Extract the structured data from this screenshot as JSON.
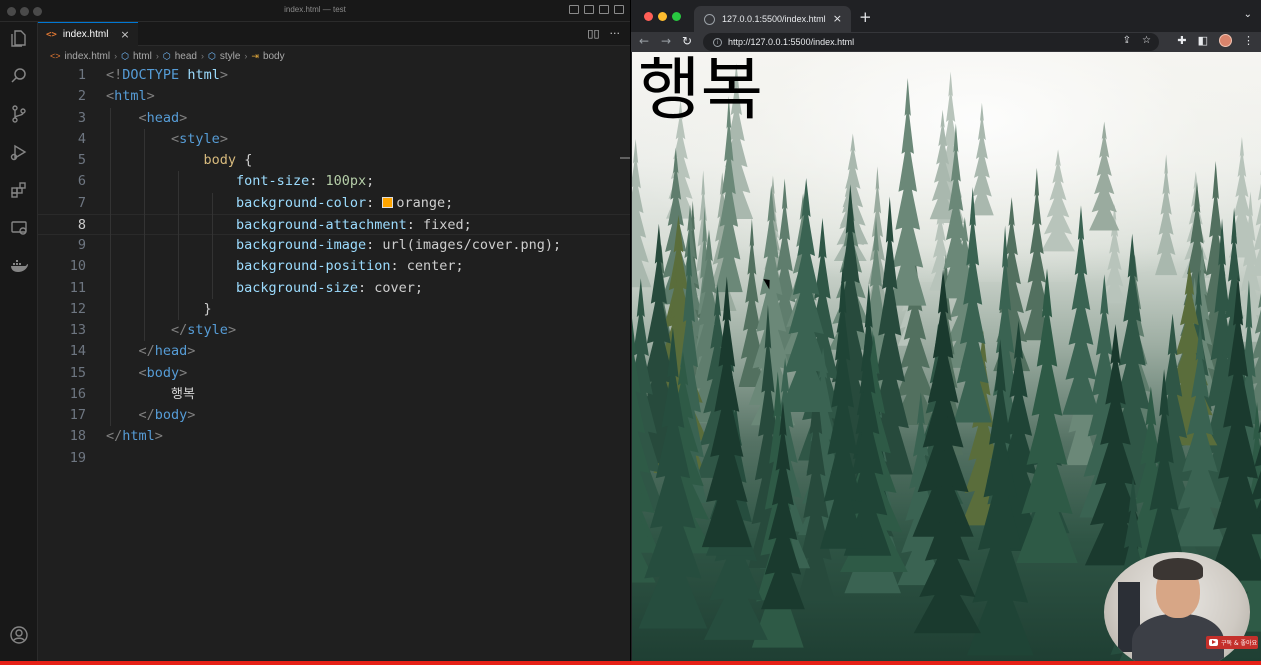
{
  "vscode": {
    "window_title": "index.html — test",
    "tab": {
      "label": "index.html",
      "icon": "<>",
      "close": "×"
    },
    "tab_actions": [
      "split-editor",
      "more"
    ],
    "breadcrumb": [
      {
        "icon": "<>",
        "label": "index.html"
      },
      {
        "icon": "⬡",
        "label": "html"
      },
      {
        "icon": "⬡",
        "label": "head"
      },
      {
        "icon": "⬡",
        "label": "style"
      },
      {
        "icon": "⇥",
        "label": "body"
      }
    ],
    "activity_icons": [
      "explorer-icon",
      "search-icon",
      "source-control-icon",
      "run-debug-icon",
      "extensions-icon",
      "remote-explorer-icon",
      "docker-icon",
      "account-icon"
    ],
    "active_line": 8,
    "lines": [
      {
        "n": "1",
        "t": [
          [
            "c-tag",
            "<!"
          ],
          [
            "c-name",
            "DOCTYPE"
          ],
          [
            "c-val",
            " "
          ],
          [
            "c-prop",
            "html"
          ],
          [
            "c-tag",
            ">"
          ]
        ]
      },
      {
        "n": "2",
        "t": [
          [
            "c-tag",
            "<"
          ],
          [
            "c-name",
            "html"
          ],
          [
            "c-tag",
            ">"
          ]
        ]
      },
      {
        "n": "3",
        "t": [
          [
            "c-val",
            "    "
          ],
          [
            "c-tag",
            "<"
          ],
          [
            "c-name",
            "head"
          ],
          [
            "c-tag",
            ">"
          ]
        ]
      },
      {
        "n": "4",
        "t": [
          [
            "c-val",
            "        "
          ],
          [
            "c-tag",
            "<"
          ],
          [
            "c-name",
            "style"
          ],
          [
            "c-tag",
            ">"
          ]
        ]
      },
      {
        "n": "5",
        "t": [
          [
            "c-val",
            "            "
          ],
          [
            "c-sel",
            "body"
          ],
          [
            "c-val",
            " {"
          ]
        ]
      },
      {
        "n": "6",
        "t": [
          [
            "c-val",
            "                "
          ],
          [
            "c-prop",
            "font-size"
          ],
          [
            "c-val",
            ": "
          ],
          [
            "c-num",
            "100px"
          ],
          [
            "c-val",
            ";"
          ]
        ]
      },
      {
        "n": "7",
        "t": [
          [
            "c-val",
            "                "
          ],
          [
            "c-prop",
            "background-color"
          ],
          [
            "c-val",
            ": "
          ],
          [
            "swatch",
            ""
          ],
          [
            "c-val",
            "orange;"
          ]
        ]
      },
      {
        "n": "8",
        "t": [
          [
            "c-val",
            "                "
          ],
          [
            "c-prop",
            "background-attachment"
          ],
          [
            "c-val",
            ": fixed;"
          ]
        ]
      },
      {
        "n": "9",
        "t": [
          [
            "c-val",
            "                "
          ],
          [
            "c-prop",
            "background-image"
          ],
          [
            "c-val",
            ": url(images/cover.png);"
          ]
        ]
      },
      {
        "n": "10",
        "t": [
          [
            "c-val",
            "                "
          ],
          [
            "c-prop",
            "background-position"
          ],
          [
            "c-val",
            ": center;"
          ]
        ]
      },
      {
        "n": "11",
        "t": [
          [
            "c-val",
            "                "
          ],
          [
            "c-prop",
            "background-size"
          ],
          [
            "c-val",
            ": cover;"
          ]
        ]
      },
      {
        "n": "12",
        "t": [
          [
            "c-val",
            "            }"
          ]
        ]
      },
      {
        "n": "13",
        "t": [
          [
            "c-val",
            "        "
          ],
          [
            "c-tag",
            "</"
          ],
          [
            "c-name",
            "style"
          ],
          [
            "c-tag",
            ">"
          ]
        ]
      },
      {
        "n": "14",
        "t": [
          [
            "c-val",
            "    "
          ],
          [
            "c-tag",
            "</"
          ],
          [
            "c-name",
            "head"
          ],
          [
            "c-tag",
            ">"
          ]
        ]
      },
      {
        "n": "15",
        "t": [
          [
            "c-val",
            "    "
          ],
          [
            "c-tag",
            "<"
          ],
          [
            "c-name",
            "body"
          ],
          [
            "c-tag",
            ">"
          ]
        ]
      },
      {
        "n": "16",
        "t": [
          [
            "c-val",
            "        "
          ],
          [
            "c-txt",
            "행복"
          ]
        ]
      },
      {
        "n": "17",
        "t": [
          [
            "c-val",
            "    "
          ],
          [
            "c-tag",
            "</"
          ],
          [
            "c-name",
            "body"
          ],
          [
            "c-tag",
            ">"
          ]
        ]
      },
      {
        "n": "18",
        "t": [
          [
            "c-tag",
            "</"
          ],
          [
            "c-name",
            "html"
          ],
          [
            "c-tag",
            ">"
          ]
        ]
      },
      {
        "n": "19",
        "t": []
      }
    ],
    "swatch_color": "#ffa500"
  },
  "browser": {
    "tab_title": "127.0.0.1:5500/index.html",
    "tab_close": "×",
    "new_tab": "+",
    "url": "http://127.0.0.1:5500/index.html",
    "page_heading": "행복"
  },
  "overlay": {
    "badge_text": "구독 & 좋아요"
  },
  "colors": {
    "accent": "#0078d4",
    "progress": "#e62117"
  }
}
